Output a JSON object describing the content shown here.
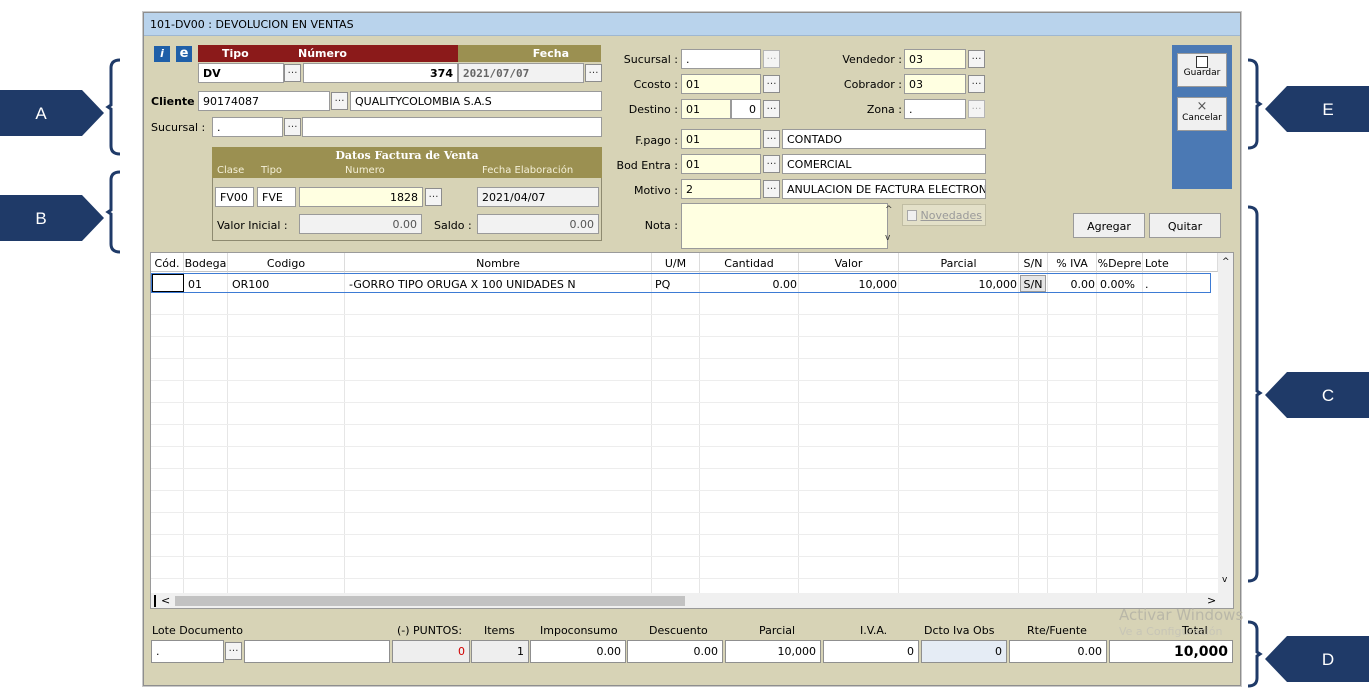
{
  "window": {
    "title": "101-DV00 : DEVOLUCION EN VENTAS"
  },
  "header": {
    "tipo_header": "Tipo",
    "numero_header": "Número",
    "fecha_header": "Fecha",
    "tipo": "DV",
    "numero": "374",
    "fecha": "2021/07/07",
    "cliente_label": "Cliente :",
    "cliente_codigo": "90174087",
    "cliente_nombre": "QUALITYCOLOMBIA S.A.S",
    "sucursal_label": "Sucursal :",
    "sucursal_value": "."
  },
  "factura": {
    "title": "Datos Factura de Venta",
    "clase_label": "Clase",
    "tipo_label": "Tipo",
    "numero_label": "Numero",
    "fecha_label": "Fecha Elaboración",
    "clase": "FV00",
    "tipo": "FVE",
    "numero": "1828",
    "fecha": "2021/04/07",
    "valor_inicial_label": "Valor Inicial :",
    "valor_inicial": "0.00",
    "saldo_label": "Saldo :",
    "saldo": "0.00"
  },
  "right_fields": {
    "sucursal_label": "Sucursal :",
    "sucursal": ".",
    "ccosto_label": "Ccosto :",
    "ccosto": "01",
    "destino_label": "Destino :",
    "destino": "01",
    "destino_num": "0",
    "vendedor_label": "Vendedor :",
    "vendedor": "03",
    "cobrador_label": "Cobrador :",
    "cobrador": "03",
    "zona_label": "Zona :",
    "zona": ".",
    "fpago_label": "F.pago :",
    "fpago": "01",
    "fpago_desc": "CONTADO",
    "bod_label": "Bod Entra :",
    "bod": "01",
    "bod_desc": "COMERCIAL",
    "motivo_label": "Motivo :",
    "motivo": "2",
    "motivo_desc": "ANULACION DE FACTURA ELECTRON",
    "nota_label": "Nota :",
    "novedades_label": "Novedades"
  },
  "toolbar": {
    "guardar": "Guardar",
    "cancelar": "Cancelar",
    "agregar": "Agregar",
    "quitar": "Quitar"
  },
  "grid": {
    "columns": [
      "Cód.",
      "Bodega",
      "Codigo",
      "Nombre",
      "U/M",
      "Cantidad",
      "Valor",
      "Parcial",
      "S/N",
      "% IVA",
      "%Depre",
      "Lote"
    ],
    "rows": [
      {
        "cod": "",
        "bodega": "01",
        "codigo": "OR100",
        "nombre": "-GORRO TIPO ORUGA X 100 UNIDADES N",
        "um": "PQ",
        "cantidad": "0.00",
        "valor": "10,000",
        "parcial": "10,000",
        "sn": "S/N",
        "iva": "0.00",
        "depre": "0.00%",
        "lote": "."
      }
    ]
  },
  "footer": {
    "lote_label": "Lote Documento",
    "lote_value": ".",
    "puntos_label": "(-) PUNTOS:",
    "puntos": "0",
    "items_label": "Items",
    "items": "1",
    "impoconsumo_label": "Impoconsumo",
    "impoconsumo": "0.00",
    "descuento_label": "Descuento",
    "descuento": "0.00",
    "parcial_label": "Parcial",
    "parcial": "10,000",
    "iva_label": "I.V.A.",
    "iva": "0",
    "dcto_label": "Dcto Iva Obs",
    "dcto": "0",
    "rte_label": "Rte/Fuente",
    "rte": "0.00",
    "total_label": "Total",
    "total": "10,000"
  },
  "watermark": {
    "line1": "Activar Windows",
    "line2": "Ve a Configuración"
  },
  "annotations": {
    "a": "A",
    "b": "B",
    "c": "C",
    "d": "D",
    "e": "E"
  },
  "colors": {
    "title_bar": "#b9d3ec",
    "window_bg": "#d7d3b6",
    "header_red": "#8b1a1a",
    "header_olive": "#9b9051",
    "callout": "#1f3a68",
    "side_panel": "#4b79b4"
  }
}
